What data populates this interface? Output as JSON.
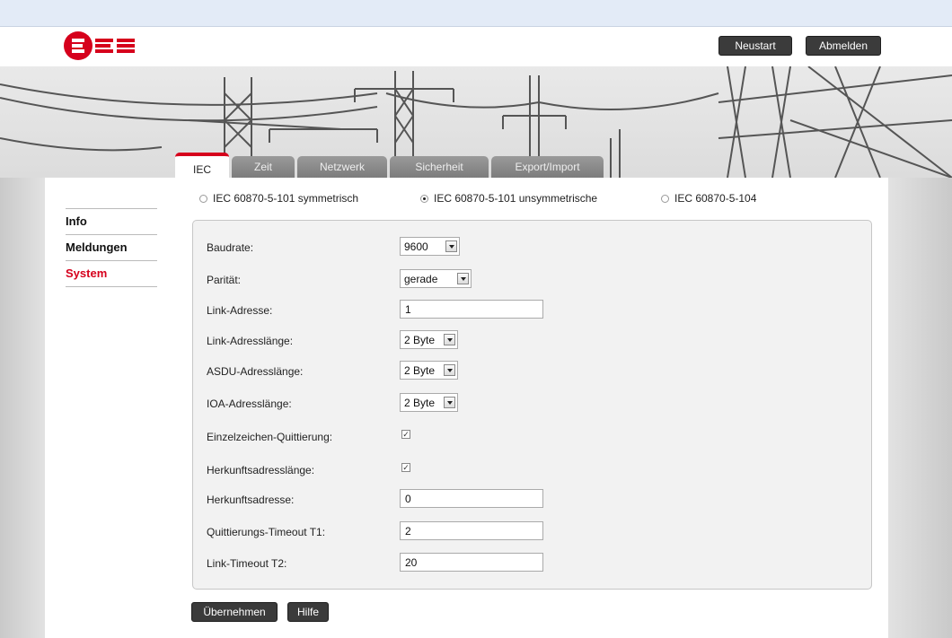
{
  "header": {
    "logo_text": "EES",
    "restart_label": "Neustart",
    "logout_label": "Abmelden"
  },
  "tabs": [
    {
      "label": "IEC",
      "active": true
    },
    {
      "label": "Zeit",
      "active": false
    },
    {
      "label": "Netzwerk",
      "active": false
    },
    {
      "label": "Sicherheit",
      "active": false
    },
    {
      "label": "Export/Import",
      "active": false
    }
  ],
  "sidebar": {
    "items": [
      {
        "label": "Info",
        "active": false
      },
      {
        "label": "Meldungen",
        "active": false
      },
      {
        "label": "System",
        "active": true
      }
    ]
  },
  "protocol": {
    "options": [
      {
        "label": "IEC 60870-5-101 symmetrisch",
        "selected": false
      },
      {
        "label": "IEC 60870-5-101 unsymmetrische",
        "selected": true
      },
      {
        "label": "IEC 60870-5-104",
        "selected": false
      }
    ]
  },
  "form": {
    "baudrate": {
      "label": "Baudrate:",
      "value": "9600"
    },
    "parity": {
      "label": "Parität:",
      "value": "gerade"
    },
    "link_address": {
      "label": "Link-Adresse:",
      "value": "1"
    },
    "link_address_length": {
      "label": "Link-Adresslänge:",
      "value": "2 Byte"
    },
    "asdu_address_length": {
      "label": "ASDU-Adresslänge:",
      "value": "2 Byte"
    },
    "ioa_address_length": {
      "label": "IOA-Adresslänge:",
      "value": "2 Byte"
    },
    "single_char_ack": {
      "label": "Einzelzeichen-Quittierung:",
      "checked": true
    },
    "origin_address_length": {
      "label": "Herkunftsadresslänge:",
      "checked": true
    },
    "origin_address": {
      "label": "Herkunftsadresse:",
      "value": "0"
    },
    "ack_timeout_t1": {
      "label": "Quittierungs-Timeout T1:",
      "value": "2"
    },
    "link_timeout_t2": {
      "label": "Link-Timeout T2:",
      "value": "20"
    }
  },
  "actions": {
    "apply_label": "Übernehmen",
    "help_label": "Hilfe"
  },
  "colors": {
    "accent_red": "#d6001c",
    "button_dark": "#3b3b3b",
    "panel_bg": "#f2f2f2"
  }
}
